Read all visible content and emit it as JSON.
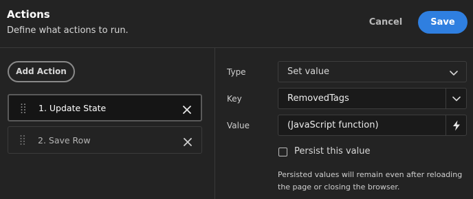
{
  "header": {
    "title": "Actions",
    "subtitle": "Define what actions to run.",
    "cancel_label": "Cancel",
    "save_label": "Save"
  },
  "actions_panel": {
    "add_label": "Add Action",
    "items": [
      {
        "label": "1. Update State",
        "selected": true
      },
      {
        "label": "2. Save Row",
        "selected": false
      }
    ]
  },
  "settings": {
    "type": {
      "label": "Type",
      "value": "Set value"
    },
    "key": {
      "label": "Key",
      "value": "RemovedTags"
    },
    "value": {
      "label": "Value",
      "value": "(JavaScript function)"
    },
    "persist": {
      "label": "Persist this value",
      "checked": false
    },
    "note": "Persisted values will remain even after reloading the page or closing the browser."
  },
  "colors": {
    "background": "#232323",
    "accent": "#2f7fe0"
  },
  "icons": {
    "drag": "drag-handle-icon",
    "remove": "close-icon",
    "dropdown": "chevron-down-icon",
    "bind": "lightning-icon"
  }
}
